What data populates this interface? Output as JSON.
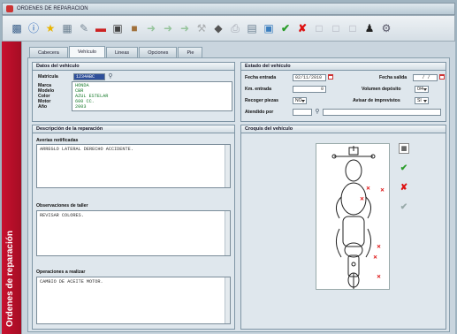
{
  "window": {
    "title": "ORDENES DE REPARACION"
  },
  "sidebar": {
    "title": "Ordenes de reparación"
  },
  "toolbar": {
    "icons": [
      "save-icon",
      "info-icon",
      "star-icon",
      "grid-icon",
      "brush-icon",
      "car-icon",
      "truck-icon",
      "box-icon",
      "arrow-right-icon",
      "arrow-right-icon",
      "arrow-right-icon",
      "tools-icon",
      "pin-icon",
      "printer-icon",
      "document-icon",
      "image-icon",
      "check-icon",
      "close-icon",
      "frame-icon",
      "frame-icon",
      "frame-icon",
      "person-icon",
      "settings-icon"
    ],
    "accent_check": "#2a9d2a",
    "accent_close": "#d11"
  },
  "tabs": [
    {
      "label": "Cabecera",
      "active": false
    },
    {
      "label": "Vehículo",
      "active": true
    },
    {
      "label": "Lineas",
      "active": false
    },
    {
      "label": "Opciones",
      "active": false
    },
    {
      "label": "Pie",
      "active": false
    }
  ],
  "vehicle": {
    "header": "Datos del vehiculo",
    "plate_label": "Matricula",
    "plate_value": "1234ABC",
    "labels": [
      "Marca",
      "Modelo",
      "Color",
      "Motor",
      "Año"
    ],
    "values": [
      "HONDA",
      "CBR",
      "AZUL ESTELAR",
      "600 CC.",
      "2003"
    ]
  },
  "state": {
    "header": "Estado del vehículo",
    "entry_date_label": "Fecha entrada",
    "entry_date_value": "02/11/2010",
    "exit_date_label": "Fecha salida",
    "exit_date_value": "/ /",
    "km_label": "Km. entrada",
    "km_value": "0",
    "deposit_label": "Volumen depósito",
    "deposit_value": "0/4",
    "parts_label": "Recoger piezas",
    "parts_value": "NO",
    "notice_label": "Avisar de imprevistos",
    "notice_value": "SI",
    "attended_label": "Atendido por"
  },
  "repair": {
    "header": "Descripción de la reparación",
    "faults_label": "Averias notificadas",
    "faults_value": "ARREGLO LATERAL DERECHO ACCIDENTE.",
    "observations_label": "Observaciones de taller",
    "observations_value": "REVISAR COLORES.",
    "operations_label": "Operaciones a realizar",
    "operations_value": "CAMBIO DE ACEITE MOTOR."
  },
  "sketch": {
    "header": "Croquis del vehículo",
    "mark_color": "#dd1111"
  }
}
